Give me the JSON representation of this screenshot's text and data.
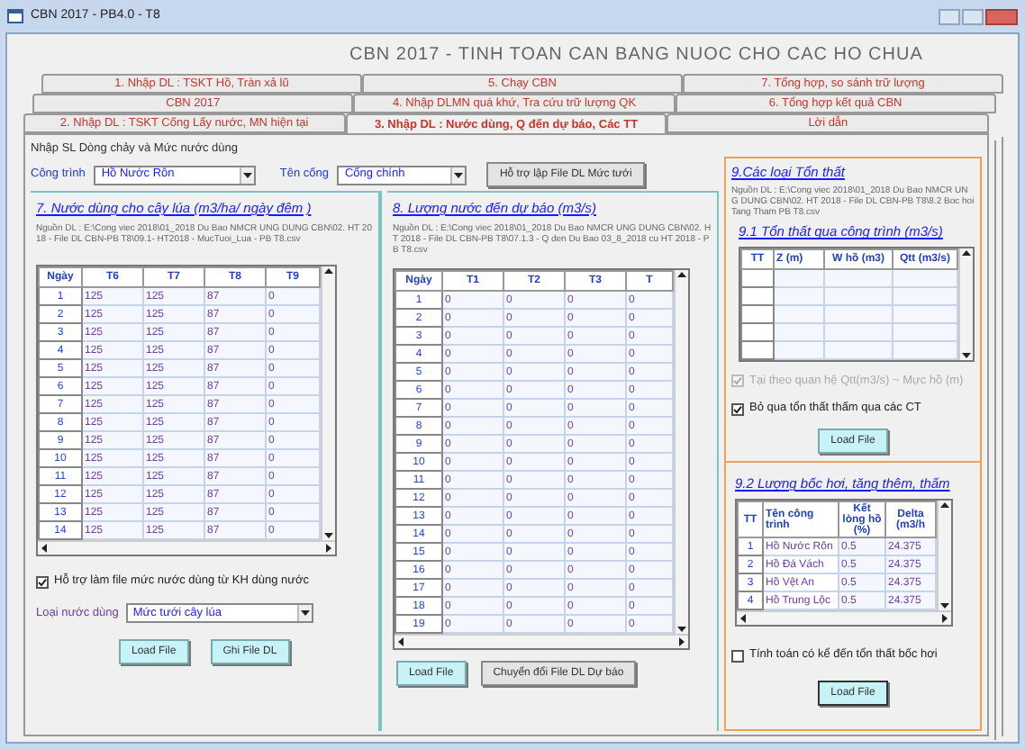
{
  "window": {
    "title": "CBN 2017 - PB4.0 - T8"
  },
  "header": "CBN 2017 - TINH TOAN CAN BANG NUOC CHO CAC HO CHUA",
  "tab_rows": [
    [
      {
        "label": "1. Nhập DL : TSKT Hồ, Tràn xả lũ",
        "selected": false
      },
      {
        "label": "5. Chạy CBN",
        "selected": false
      },
      {
        "label": "7. Tổng hợp, so sánh trữ lượng",
        "selected": false
      }
    ],
    [
      {
        "label": "CBN 2017",
        "selected": false
      },
      {
        "label": "4. Nhập DLMN quá khứ, Tra cứu trữ lượng QK",
        "selected": false
      },
      {
        "label": "6. Tổng hợp kết quả CBN",
        "selected": false
      }
    ],
    [
      {
        "label": "2. Nhập DL : TSKT Cống Lấy nước, MN hiện tại",
        "selected": false
      },
      {
        "label": "3. Nhập DL : Nước dùng, Q đến dự báo, Các TT",
        "selected": true
      },
      {
        "label": "Lời dẫn",
        "selected": false
      }
    ]
  ],
  "group": {
    "title": "Nhập SL Dòng chảy và Mức nước dùng",
    "fields": [
      {
        "label": "Công trình",
        "value": "Hồ Nước Rôn"
      },
      {
        "label": "Tên cống",
        "value": "Cống chính"
      }
    ],
    "helper_button": {
      "label": "Hỗ trợ lập File DL Mức tưới",
      "highlight": false
    }
  },
  "water_use": {
    "title": "7. Nước dùng cho cây lúa (m3/ha/ ngày đêm )",
    "source": "Nguồn DL : E:\\Cong viec 2018\\01_2018 Du Bao NMCR UNG DUNG CBN\\02. HT 2018 - File DL CBN-PB T8\\09.1- HT2018 - MucTuoi_Lua - PB T8.csv",
    "table": {
      "columns": [
        "Ngày",
        "T6",
        "T7",
        "T8",
        "T9"
      ],
      "rows": [
        [
          "1",
          "125",
          "125",
          "87",
          "0"
        ],
        [
          "2",
          "125",
          "125",
          "87",
          "0"
        ],
        [
          "3",
          "125",
          "125",
          "87",
          "0"
        ],
        [
          "4",
          "125",
          "125",
          "87",
          "0"
        ],
        [
          "5",
          "125",
          "125",
          "87",
          "0"
        ],
        [
          "6",
          "125",
          "125",
          "87",
          "0"
        ],
        [
          "7",
          "125",
          "125",
          "87",
          "0"
        ],
        [
          "8",
          "125",
          "125",
          "87",
          "0"
        ],
        [
          "9",
          "125",
          "125",
          "87",
          "0"
        ],
        [
          "10",
          "125",
          "125",
          "87",
          "0"
        ],
        [
          "11",
          "125",
          "125",
          "87",
          "0"
        ],
        [
          "12",
          "125",
          "125",
          "87",
          "0"
        ],
        [
          "13",
          "125",
          "125",
          "87",
          "0"
        ],
        [
          "14",
          "125",
          "125",
          "87",
          "0"
        ]
      ]
    },
    "checkbox": {
      "label": "Hỗ trợ làm file mức nước dùng từ KH dùng nước",
      "checked": true
    },
    "use_type": {
      "label": "Loại nước dùng",
      "value": "Mức tưới cây lúa"
    },
    "buttons": [
      {
        "label": "Load File",
        "highlight": true
      },
      {
        "label": "Ghi File DL",
        "highlight": true
      }
    ]
  },
  "inflow": {
    "title": "8. Lượng nước đến dự báo (m3/s)",
    "source": "Nguồn DL : E:\\Cong viec 2018\\01_2018 Du Bao NMCR UNG DUNG CBN\\02. HT 2018 - File DL CBN-PB T8\\07.1.3 - Q den Du Bao 03_8_2018 cu HT 2018 - PB T8.csv",
    "table": {
      "columns": [
        "Ngày",
        "T1",
        "T2",
        "T3",
        "T"
      ],
      "rows": [
        [
          "1",
          "0",
          "0",
          "0",
          "0"
        ],
        [
          "2",
          "0",
          "0",
          "0",
          "0"
        ],
        [
          "3",
          "0",
          "0",
          "0",
          "0"
        ],
        [
          "4",
          "0",
          "0",
          "0",
          "0"
        ],
        [
          "5",
          "0",
          "0",
          "0",
          "0"
        ],
        [
          "6",
          "0",
          "0",
          "0",
          "0"
        ],
        [
          "7",
          "0",
          "0",
          "0",
          "0"
        ],
        [
          "8",
          "0",
          "0",
          "0",
          "0"
        ],
        [
          "9",
          "0",
          "0",
          "0",
          "0"
        ],
        [
          "10",
          "0",
          "0",
          "0",
          "0"
        ],
        [
          "11",
          "0",
          "0",
          "0",
          "0"
        ],
        [
          "12",
          "0",
          "0",
          "0",
          "0"
        ],
        [
          "13",
          "0",
          "0",
          "0",
          "0"
        ],
        [
          "14",
          "0",
          "0",
          "0",
          "0"
        ],
        [
          "15",
          "0",
          "0",
          "0",
          "0"
        ],
        [
          "16",
          "0",
          "0",
          "0",
          "0"
        ],
        [
          "17",
          "0",
          "0",
          "0",
          "0"
        ],
        [
          "18",
          "0",
          "0",
          "0",
          "0"
        ],
        [
          "19",
          "0",
          "0",
          "0",
          "0"
        ]
      ]
    },
    "buttons": [
      {
        "label": "Load File",
        "highlight": true
      },
      {
        "label": "Chuyển đổi File DL Dự báo",
        "highlight": false
      }
    ]
  },
  "losses": {
    "title": "9.Các loại Tổn thất",
    "source": "Nguồn DL : E:\\Cong viec 2018\\01_2018 Du Bao NMCR UNG DUNG CBN\\02. HT 2018 - File DL CBN-PB T8\\8.2 Boc hoi Tang Tham PB T8.csv",
    "structure_loss": {
      "title": "9.1 Tổn thất qua công trình (m3/s)",
      "columns": [
        "TT",
        "Z (m)",
        "W hồ (m3)",
        "Qtt (m3/s)"
      ]
    },
    "checkboxes": [
      {
        "label": "Tại theo quan hệ Qtt(m3/s) ~ Mực hồ (m)",
        "checked": true,
        "disabled": true
      },
      {
        "label": "Bỏ qua tổn thất thấm qua các CT",
        "checked": true,
        "disabled": false
      }
    ],
    "button": {
      "label": "Load File",
      "highlight": true
    },
    "evaporation": {
      "title": "9.2 Lượng bốc hơi, tăng thêm, thấm",
      "columns": [
        "TT",
        "Tên công trình",
        "Kết lòng hồ (%)",
        "Delta (m3/h"
      ],
      "rows": [
        [
          "1",
          "Hồ Nước Rôn",
          "0.5",
          "24.375"
        ],
        [
          "2",
          "Hồ Đá Vách",
          "0.5",
          "24.375"
        ],
        [
          "3",
          "Hồ Vệt An",
          "0.5",
          "24.375"
        ],
        [
          "4",
          "Hồ Trung Lộc",
          "0.5",
          "24.375"
        ]
      ],
      "checkbox": {
        "label": "Tính toán có kể đến tổn thất bốc hơi",
        "checked": false
      },
      "button": {
        "label": "Load File",
        "highlight": true
      }
    }
  }
}
